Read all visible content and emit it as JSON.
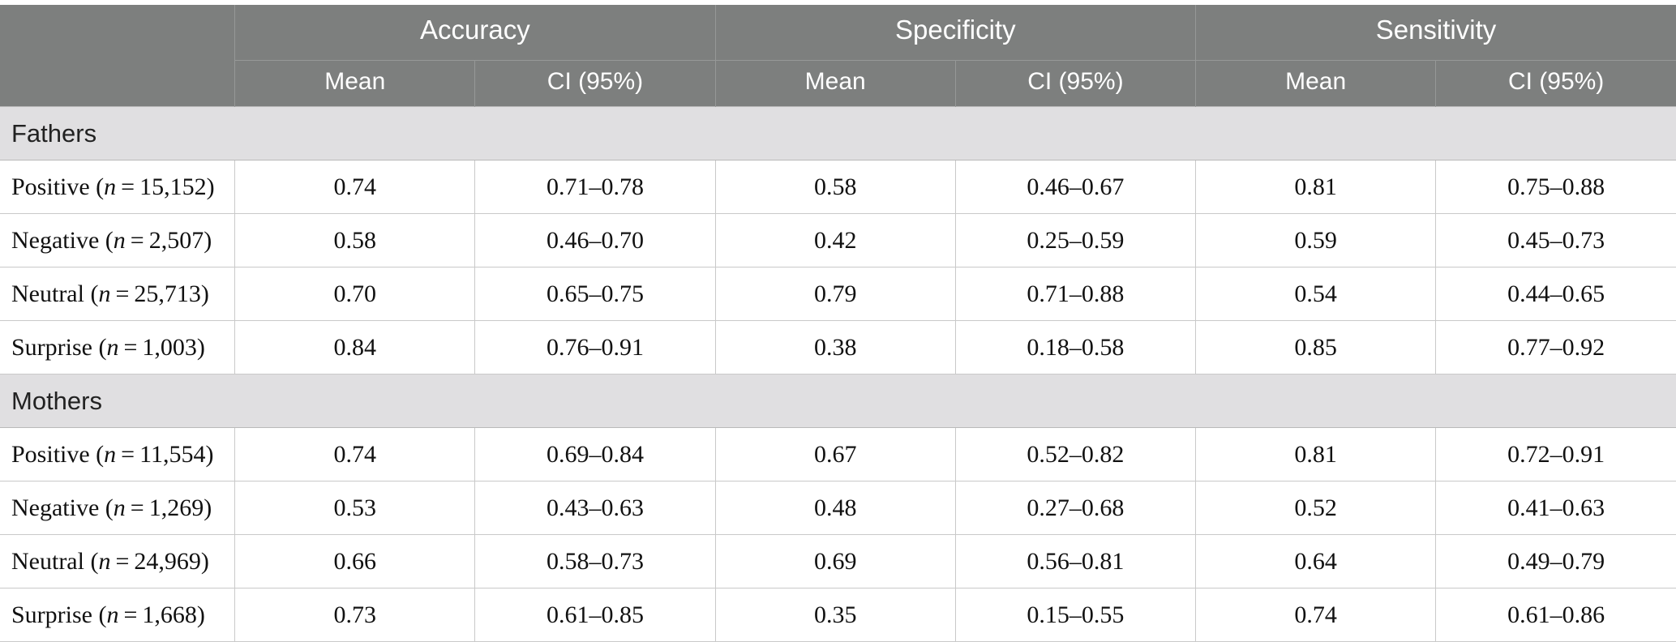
{
  "table": {
    "corner_label": "",
    "groups": [
      {
        "key": "accuracy",
        "label": "Accuracy"
      },
      {
        "key": "specificity",
        "label": "Specificity"
      },
      {
        "key": "sensitivity",
        "label": "Sensitivity"
      }
    ],
    "subheaders": {
      "mean": "Mean",
      "ci": "CI (95%)"
    },
    "sections": [
      {
        "title": "Fathers",
        "rows": [
          {
            "emotion": "Positive",
            "n": "15,152",
            "label": "Positive (n = 15,152)",
            "accuracy_mean": "0.74",
            "accuracy_ci": "0.71–0.78",
            "specificity_mean": "0.58",
            "specificity_ci": "0.46–0.67",
            "sensitivity_mean": "0.81",
            "sensitivity_ci": "0.75–0.88"
          },
          {
            "emotion": "Negative",
            "n": "2,507",
            "label": "Negative (n = 2,507)",
            "accuracy_mean": "0.58",
            "accuracy_ci": "0.46–0.70",
            "specificity_mean": "0.42",
            "specificity_ci": "0.25–0.59",
            "sensitivity_mean": "0.59",
            "sensitivity_ci": "0.45–0.73"
          },
          {
            "emotion": "Neutral",
            "n": "25,713",
            "label": "Neutral (n = 25,713)",
            "accuracy_mean": "0.70",
            "accuracy_ci": "0.65–0.75",
            "specificity_mean": "0.79",
            "specificity_ci": "0.71–0.88",
            "sensitivity_mean": "0.54",
            "sensitivity_ci": "0.44–0.65"
          },
          {
            "emotion": "Surprise",
            "n": "1,003",
            "label": "Surprise (n = 1,003)",
            "accuracy_mean": "0.84",
            "accuracy_ci": "0.76–0.91",
            "specificity_mean": "0.38",
            "specificity_ci": "0.18–0.58",
            "sensitivity_mean": "0.85",
            "sensitivity_ci": "0.77–0.92"
          }
        ]
      },
      {
        "title": "Mothers",
        "rows": [
          {
            "emotion": "Positive",
            "n": "11,554",
            "label": "Positive (n = 11,554)",
            "accuracy_mean": "0.74",
            "accuracy_ci": "0.69–0.84",
            "specificity_mean": "0.67",
            "specificity_ci": "0.52–0.82",
            "sensitivity_mean": "0.81",
            "sensitivity_ci": "0.72–0.91"
          },
          {
            "emotion": "Negative",
            "n": "1,269",
            "label": "Negative (n = 1,269)",
            "accuracy_mean": "0.53",
            "accuracy_ci": "0.43–0.63",
            "specificity_mean": "0.48",
            "specificity_ci": "0.27–0.68",
            "sensitivity_mean": "0.52",
            "sensitivity_ci": "0.41–0.63"
          },
          {
            "emotion": "Neutral",
            "n": "24,969",
            "label": "Neutral (n = 24,969)",
            "accuracy_mean": "0.66",
            "accuracy_ci": "0.58–0.73",
            "specificity_mean": "0.69",
            "specificity_ci": "0.56–0.81",
            "sensitivity_mean": "0.64",
            "sensitivity_ci": "0.49–0.79"
          },
          {
            "emotion": "Surprise",
            "n": "1,668",
            "label": "Surprise (n = 1,668)",
            "accuracy_mean": "0.73",
            "accuracy_ci": "0.61–0.85",
            "specificity_mean": "0.35",
            "specificity_ci": "0.15–0.55",
            "sensitivity_mean": "0.74",
            "sensitivity_ci": "0.61–0.86"
          }
        ]
      }
    ],
    "colors": {
      "header_bg": "#7d7f7e",
      "header_text": "#ffffff",
      "section_bg": "#e0dfe1",
      "section_text": "#222222",
      "cell_bg": "#ffffff",
      "cell_text": "#111111",
      "grid_line": "#c9c9c9"
    }
  }
}
